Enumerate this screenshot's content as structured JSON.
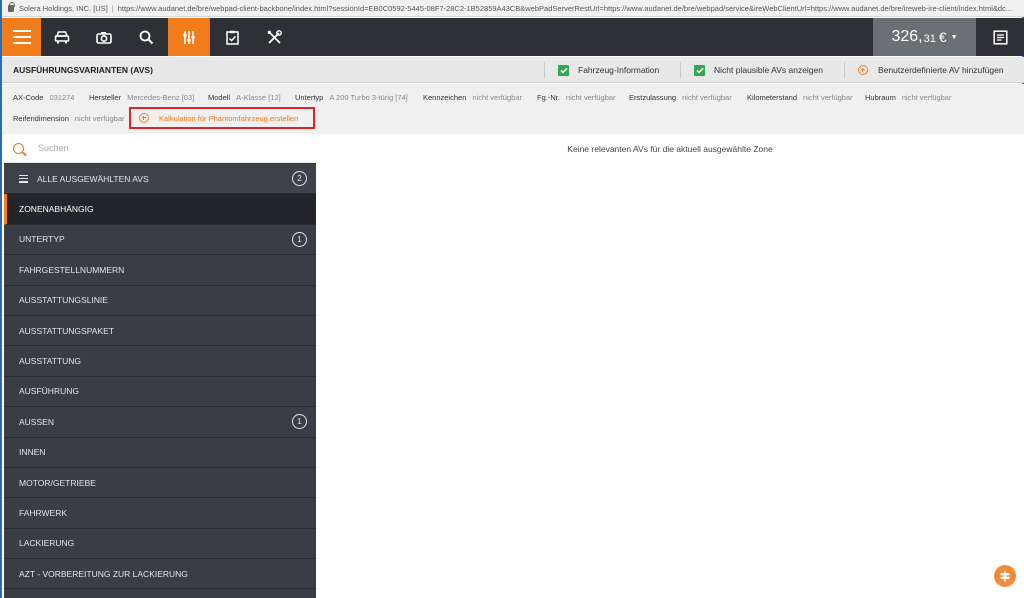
{
  "browser": {
    "site_owner": "Solera Holdings, INC. [US]",
    "url": "https://www.audanet.de/bre/webpad-client-backbone/index.html?sessionId=EB0C0592-5445-08F7-28C2-1B52859A43CB&webPadServerRestUrl=https://www.audanet.de/bre/webpad/service&ireWebClientUrl=https://www.audanet.de/bre/ireweb-ire-client/index.html&dc..."
  },
  "navbar": {
    "icons": [
      "menu-icon",
      "car-icon",
      "camera-icon",
      "search-icon",
      "sliders-icon",
      "clipboard-check-icon",
      "tools-icon"
    ],
    "price_main": "326,",
    "price_decimals": "31",
    "price_currency": "€",
    "accent_color": "#f07c1c",
    "bar_color": "#2e3035"
  },
  "title": {
    "text": "AUSFÜHRUNGSVARIANTEN (AVS)",
    "options": {
      "vehicle_info": "Fahrzeug-Information",
      "implausible": "Nicht plausible AVs anzeigen",
      "custom_av": "Benutzerdefinierte AV hinzufügen"
    }
  },
  "info": {
    "ax_code": {
      "label": "AX-Code",
      "value": "031274"
    },
    "manufacturer": {
      "label": "Hersteller",
      "value": "Mercedes-Benz [03]"
    },
    "model": {
      "label": "Modell",
      "value": "A-Klasse [12]"
    },
    "subtype": {
      "label": "Untertyp",
      "value": "A 200 Turbo 3-türig [74]"
    },
    "plate": {
      "label": "Kennzeichen",
      "value": "nicht verfügbar"
    },
    "vin": {
      "label": "Fg.-Nr.",
      "value": "nicht verfügbar"
    },
    "registration": {
      "label": "Erstzulassung",
      "value": "nicht verfügbar"
    },
    "mileage": {
      "label": "Kilometerstand",
      "value": "nicht verfügbar"
    },
    "displacement": {
      "label": "Hubraum",
      "value": "nicht verfügbar"
    },
    "tire": {
      "label": "Reifendimension",
      "value": "nicht verfügbar"
    },
    "phantom_link": "Kalkulation für Phantomfahrzeug erstellen"
  },
  "sidebar": {
    "search_placeholder": "Suchen",
    "items": [
      {
        "label": "ALLE AUSGEWÄHLTEN AVS",
        "badge": "2"
      },
      {
        "label": "ZONENABHÄNGIG",
        "badge": ""
      },
      {
        "label": "UNTERTYP",
        "badge": "1"
      },
      {
        "label": "FAHRGESTELLNUMMERN",
        "badge": ""
      },
      {
        "label": "AUSSTATTUNGSLINIE",
        "badge": ""
      },
      {
        "label": "AUSSTATTUNGSPAKET",
        "badge": ""
      },
      {
        "label": "AUSSTATTUNG",
        "badge": ""
      },
      {
        "label": "AUSFÜHRUNG",
        "badge": ""
      },
      {
        "label": "AUSSEN",
        "badge": "1"
      },
      {
        "label": "INNEN",
        "badge": ""
      },
      {
        "label": "MOTOR/GETRIEBE",
        "badge": ""
      },
      {
        "label": "FAHRWERK",
        "badge": ""
      },
      {
        "label": "LACKIERUNG",
        "badge": ""
      },
      {
        "label": "AZT - VORBEREITUNG ZUR LACKIERUNG",
        "badge": ""
      }
    ]
  },
  "main": {
    "empty_message": "Keine relevanten AVs für die aktuell ausgewählte Zone"
  }
}
